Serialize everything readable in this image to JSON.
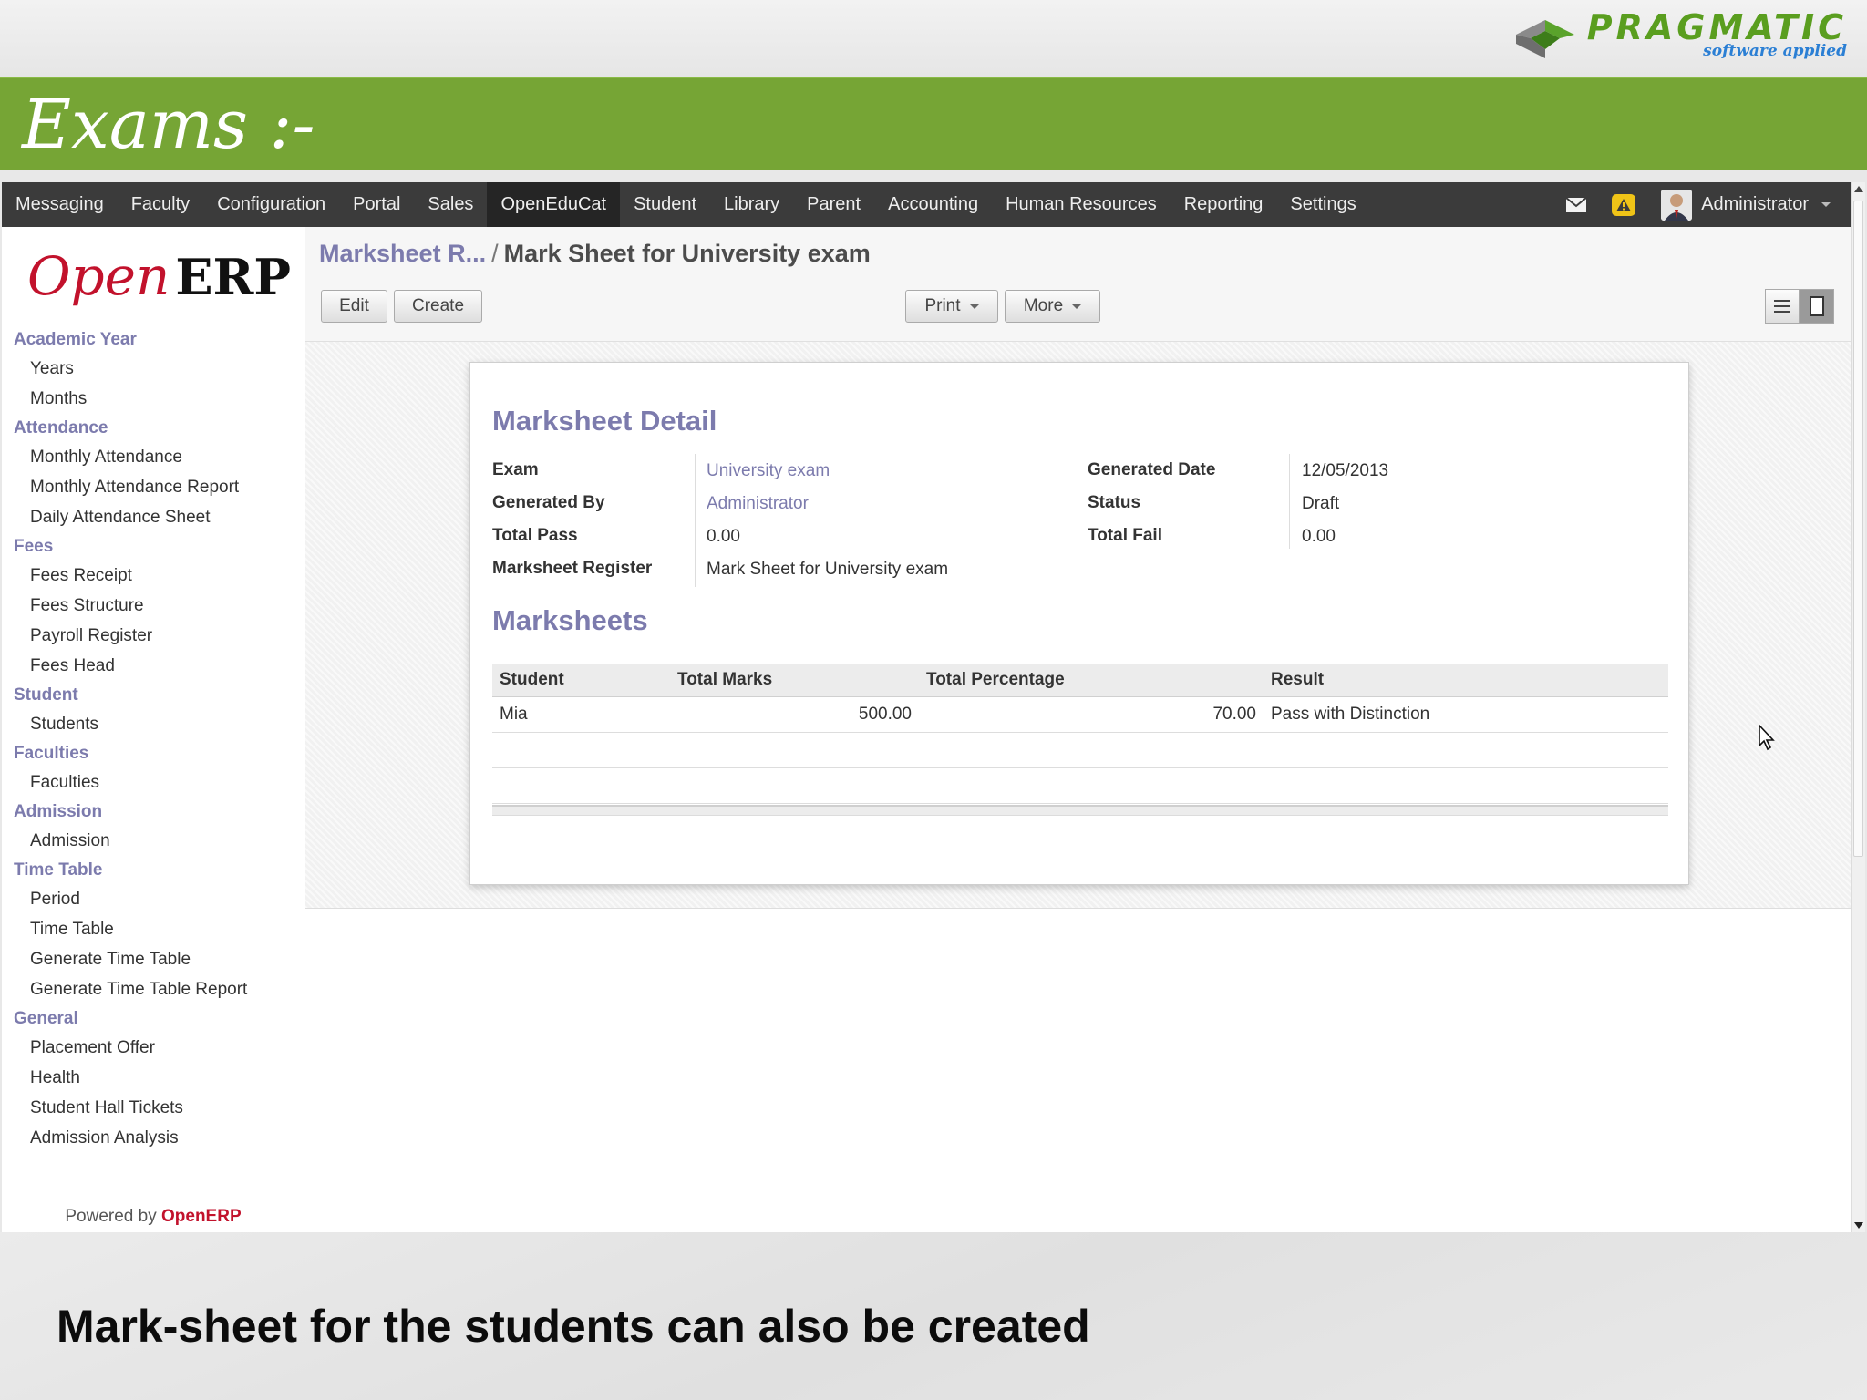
{
  "slide": {
    "title": "Exams :-",
    "caption": "Mark-sheet for the students can also be created",
    "brand": {
      "name": "PRAGMATIC",
      "tagline": "software applied"
    }
  },
  "topbar": {
    "items": [
      "Messaging",
      "Faculty",
      "Configuration",
      "Portal",
      "Sales",
      "OpenEduCat",
      "Student",
      "Library",
      "Parent",
      "Accounting",
      "Human Resources",
      "Reporting",
      "Settings"
    ],
    "active": "OpenEduCat",
    "user": "Administrator",
    "icons": [
      "mail-icon",
      "warning-icon",
      "avatar"
    ]
  },
  "sidebar": {
    "logo": {
      "open": "Open",
      "erp": "ERP"
    },
    "sections": [
      {
        "title": "Academic Year",
        "items": [
          "Years",
          "Months"
        ]
      },
      {
        "title": "Attendance",
        "items": [
          "Monthly Attendance",
          "Monthly Attendance Report",
          "Daily Attendance Sheet"
        ]
      },
      {
        "title": "Fees",
        "items": [
          "Fees Receipt",
          "Fees Structure",
          "Payroll Register",
          "Fees Head"
        ]
      },
      {
        "title": "Student",
        "items": [
          "Students"
        ]
      },
      {
        "title": "Faculties",
        "items": [
          "Faculties"
        ]
      },
      {
        "title": "Admission",
        "items": [
          "Admission"
        ]
      },
      {
        "title": "Time Table",
        "items": [
          "Period",
          "Time Table",
          "Generate Time Table",
          "Generate Time Table Report"
        ]
      },
      {
        "title": "General",
        "items": [
          "Placement Offer",
          "Health",
          "Student Hall Tickets",
          "Admission Analysis"
        ]
      }
    ],
    "powered_by": "Powered by",
    "powered_brand": "OpenERP"
  },
  "header": {
    "breadcrumb_parent": "Marksheet R...",
    "breadcrumb_sep": "/",
    "breadcrumb_current": "Mark Sheet for University exam",
    "buttons": {
      "edit": "Edit",
      "create": "Create",
      "print": "Print",
      "more": "More"
    }
  },
  "form": {
    "section_title": "Marksheet Detail",
    "fields": {
      "exam": {
        "label": "Exam",
        "value": "University exam"
      },
      "generated_by": {
        "label": "Generated By",
        "value": "Administrator"
      },
      "total_pass": {
        "label": "Total Pass",
        "value": "0.00"
      },
      "marksheet_register": {
        "label": "Marksheet Register",
        "value": "Mark Sheet for University exam"
      },
      "generated_date": {
        "label": "Generated Date",
        "value": "12/05/2013"
      },
      "status": {
        "label": "Status",
        "value": "Draft"
      },
      "total_fail": {
        "label": "Total Fail",
        "value": "0.00"
      }
    },
    "marksheets": {
      "title": "Marksheets",
      "columns": [
        "Student",
        "Total Marks",
        "Total Percentage",
        "Result"
      ],
      "rows": [
        {
          "student": "Mia",
          "total_marks": "500.00",
          "total_percentage": "70.00",
          "result": "Pass with Distinction"
        }
      ]
    }
  },
  "colors": {
    "accent": "#7c7bad",
    "slide_green": "#76a535",
    "topbar": "#3b3b3b",
    "brand_red": "#c2122c"
  }
}
